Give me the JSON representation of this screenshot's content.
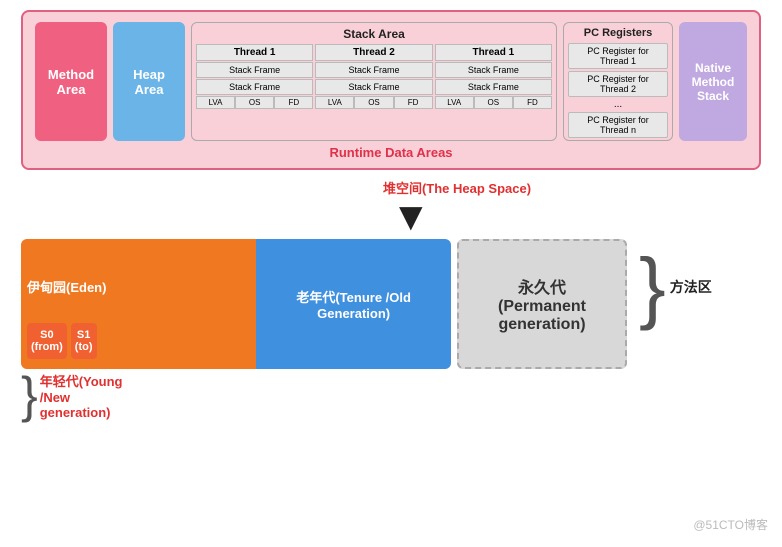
{
  "top": {
    "method_area": "Method\nArea",
    "heap_area": "Heap\nArea",
    "stack_area_title": "Stack Area",
    "threads": [
      "Thread 1",
      "Thread 2",
      "Thread 1"
    ],
    "stack_frames": [
      "Stack Frame",
      "Stack Frame"
    ],
    "lva_items": [
      "LVA",
      "OS",
      "FD"
    ],
    "pc_registers_title": "PC Registers",
    "pc_registers": [
      "PC Register for\nThread 1",
      "PC Register for\nThread 2",
      "...",
      "PC Register for\nThread n"
    ],
    "native_method_stack": "Native\nMethod\nStack",
    "runtime_label": "Runtime Data Areas"
  },
  "arrow": {
    "heap_space_label": "堆空间(The Heap Space)"
  },
  "bottom": {
    "eden_label": "伊甸园(Eden)",
    "s0_label": "S0\n(from)",
    "s1_label": "S1\n(to)",
    "tenure_label": "老年代(Tenure /Old\nGeneration)",
    "perm_label": "永久代\n(Permanent\ngeneration)",
    "young_gen_label": "年轻代(Young\n/New\ngeneration)",
    "fangfa_label": "方法区"
  },
  "watermark": "@51CTO博客"
}
